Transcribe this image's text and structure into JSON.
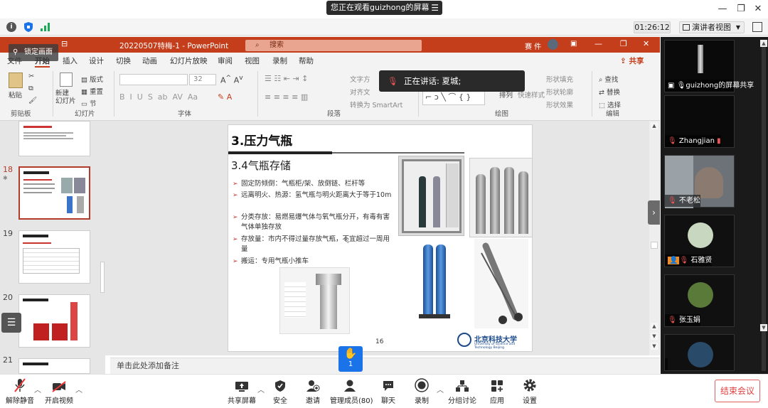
{
  "screen_banner": {
    "text": "您正在观看guizhong的屏幕",
    "menu_icon": "menu-lines-icon"
  },
  "meeting": {
    "timer": "01:26:12",
    "view_mode": "演讲者视图"
  },
  "ppt": {
    "window_title": "20220507特梅-1  -  PowerPoint",
    "search_placeholder": "搜索",
    "user_short": "赛 件",
    "share_label": "共享",
    "tabs": [
      "文件",
      "开始",
      "插入",
      "设计",
      "切换",
      "动画",
      "幻灯片放映",
      "审阅",
      "视图",
      "录制",
      "帮助"
    ],
    "ribbon": {
      "paste": "粘贴",
      "new_slide": "新建\n幻灯片",
      "layout": "版式",
      "reset": "重置",
      "section": "节",
      "font_size": "32",
      "text_direction": "文字方",
      "align_text": "对齐文",
      "convert_smartart": "转换为 SmartArt",
      "arrange": "排列",
      "quick_styles": "快速样式",
      "shape_fill": "形状填充",
      "shape_outline": "形状轮廓",
      "shape_effects": "形状效果",
      "find": "查找",
      "replace": "替换",
      "select": "选择",
      "groups": [
        "剪贴板",
        "幻灯片",
        "字体",
        "段落",
        "绘图",
        "编辑"
      ]
    },
    "thumb_numbers": [
      "18",
      "19",
      "20",
      "21"
    ],
    "notes_placeholder": "单击此处添加备注"
  },
  "slide": {
    "title": "3.压力气瓶",
    "subtitle": "3.4气瓶存储",
    "bullets": [
      "固定防倾倒：气瓶柜/架、放倒链、栏杆等",
      "远离明火、热源：氢气瓶与明火距离大于等于10m",
      "分类存放：易燃易爆气体与氧气瓶分开，有毒有害气体单独存放",
      "存放量：市内不得过量存放气瓶，不宜超过一周用量",
      "搬运：专用气瓶小推车"
    ],
    "page_number": "16",
    "university": "北京科技大学",
    "university_en": "University of Science and Technology Beijing"
  },
  "talking": {
    "text": "正在讲话: 夏城;"
  },
  "lock_screen": "锁定画面",
  "participants": [
    {
      "name": "guizhong的屏幕共享"
    },
    {
      "name": "Zhangjian"
    },
    {
      "name": "不老松"
    },
    {
      "name": "石雅贤"
    },
    {
      "name": "张玉娟"
    },
    {
      "name": ""
    }
  ],
  "raise_hand_count": "1",
  "toolbar": {
    "unmute": "解除静音",
    "start_video": "开启视频",
    "share_screen": "共享屏幕",
    "security": "安全",
    "invite": "邀请",
    "manage_members": "管理成员(80)",
    "chat": "聊天",
    "record": "录制",
    "breakout": "分组讨论",
    "apps": "应用",
    "settings": "设置",
    "end_meeting": "结束会议"
  },
  "colors": {
    "ppt_red": "#c43e1c",
    "accent_blue": "#1a73e8",
    "end_red": "#e04040",
    "signal_green": "#1aaa55"
  }
}
